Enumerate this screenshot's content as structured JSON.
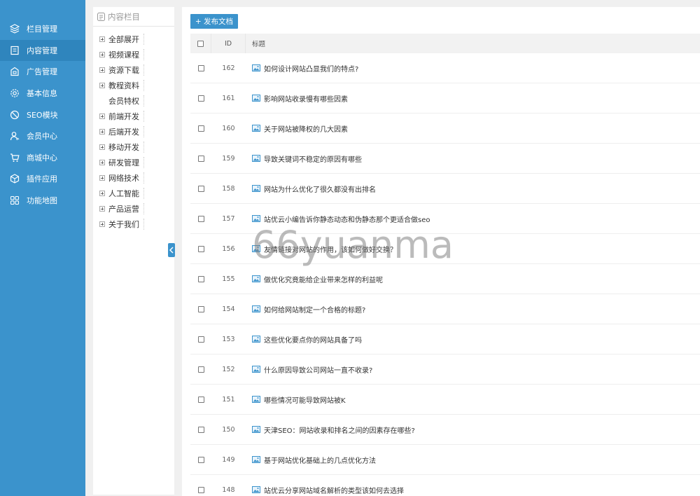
{
  "sidebar": {
    "items": [
      {
        "label": "栏目管理",
        "icon": "layers-icon"
      },
      {
        "label": "内容管理",
        "icon": "document-icon",
        "active": true
      },
      {
        "label": "广告管理",
        "icon": "ad-icon"
      },
      {
        "label": "基本信息",
        "icon": "gear-icon"
      },
      {
        "label": "SEO模块",
        "icon": "seo-icon"
      },
      {
        "label": "会员中心",
        "icon": "user-icon"
      },
      {
        "label": "商城中心",
        "icon": "cart-icon"
      },
      {
        "label": "插件应用",
        "icon": "cube-icon"
      },
      {
        "label": "功能地图",
        "icon": "grid-icon"
      }
    ]
  },
  "tree": {
    "header": "内容栏目",
    "items": [
      {
        "label": "全部展开",
        "toggle": true
      },
      {
        "label": "视频课程",
        "toggle": true
      },
      {
        "label": "资源下载",
        "toggle": true
      },
      {
        "label": "教程资料",
        "toggle": true
      },
      {
        "label": "会员特权",
        "toggle": false
      },
      {
        "label": "前端开发",
        "toggle": true
      },
      {
        "label": "后端开发",
        "toggle": true
      },
      {
        "label": "移动开发",
        "toggle": true
      },
      {
        "label": "研发管理",
        "toggle": true
      },
      {
        "label": "网络技术",
        "toggle": true
      },
      {
        "label": "人工智能",
        "toggle": true
      },
      {
        "label": "产品运营",
        "toggle": true
      },
      {
        "label": "关于我们",
        "toggle": true
      }
    ]
  },
  "main": {
    "publish_label": "+ 发布文档",
    "columns": {
      "id": "ID",
      "title": "标题"
    },
    "rows": [
      {
        "id": "162",
        "title": "如何设计网站凸显我们的特点?"
      },
      {
        "id": "161",
        "title": "影响网站收录慢有哪些因素"
      },
      {
        "id": "160",
        "title": "关于网站被降权的几大因素"
      },
      {
        "id": "159",
        "title": "导致关键词不稳定的原因有哪些"
      },
      {
        "id": "158",
        "title": "网站为什么优化了很久都没有出排名"
      },
      {
        "id": "157",
        "title": "站优云小编告诉你静态动态和伪静态那个更适合做seo"
      },
      {
        "id": "156",
        "title": "友情链接对网站的作用，该如何做好交换？"
      },
      {
        "id": "155",
        "title": "做优化究竟能给企业带来怎样的利益呢"
      },
      {
        "id": "154",
        "title": "如何给网站制定一个合格的标题?"
      },
      {
        "id": "153",
        "title": "这些优化要点你的网站具备了吗"
      },
      {
        "id": "152",
        "title": "什么原因导致公司网站一直不收录?"
      },
      {
        "id": "151",
        "title": "哪些情况可能导致网站被K"
      },
      {
        "id": "150",
        "title": "天津SEO：网站收录和排名之间的因素存在哪些?"
      },
      {
        "id": "149",
        "title": "基于网站优化基础上的几点优化方法"
      },
      {
        "id": "148",
        "title": "站优云分享网站域名解析的类型该如何去选择"
      }
    ]
  },
  "watermark": "66yuanma",
  "colors": {
    "accent": "#3b93cc",
    "active": "#2f85bd",
    "background": "#f0f0f0"
  }
}
